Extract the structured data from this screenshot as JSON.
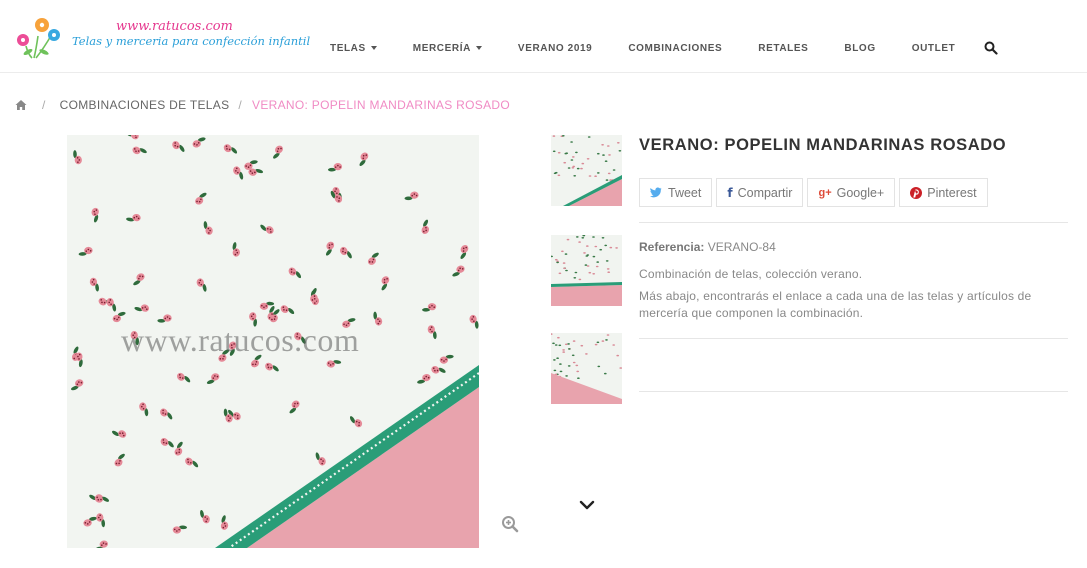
{
  "header": {
    "logo_url_text": "www.ratucos.com",
    "logo_tagline": "Telas y merceria para confección infantil",
    "nav": [
      {
        "label": "TELAS",
        "has_caret": true
      },
      {
        "label": "MERCERÍA",
        "has_caret": true
      },
      {
        "label": "VERANO 2019",
        "has_caret": false
      },
      {
        "label": "COMBINACIONES",
        "has_caret": false
      },
      {
        "label": "RETALES",
        "has_caret": false
      },
      {
        "label": "BLOG",
        "has_caret": false
      },
      {
        "label": "OUTLET",
        "has_caret": false
      }
    ],
    "search_icon": "search-icon"
  },
  "breadcrumb": {
    "home_icon": "home-icon",
    "separator": "/",
    "link": "COMBINACIONES DE TELAS",
    "current": "VERANO: POPELIN MANDARINAS ROSADO"
  },
  "gallery": {
    "watermark": "www.ratucos.com",
    "zoom_icon": "zoom-in-icon",
    "thumbs_down_icon": "chevron-down-icon"
  },
  "product": {
    "title": "VERANO: POPELIN MANDARINAS ROSADO",
    "share": {
      "tweet": "Tweet",
      "facebook": "Compartir",
      "google": "Google+",
      "pinterest": "Pinterest"
    },
    "reference_label": "Referencia:",
    "reference_value": "VERANO-84",
    "description_1": "Combinación de telas, colección verano.",
    "description_2": "Más abajo, encontrarás el enlace a cada una de las telas y artículos de mercería que componen la combinación."
  },
  "colors": {
    "pink_accent": "#f08bc4",
    "logo_pink": "#e5398f",
    "logo_blue": "#2a9fd8",
    "twitter": "#55acee",
    "facebook": "#3b5998",
    "google": "#dd4b39",
    "pinterest": "#cb2027",
    "fabric_pink": "#e8a3ad",
    "trim_green": "#2a9d78"
  }
}
